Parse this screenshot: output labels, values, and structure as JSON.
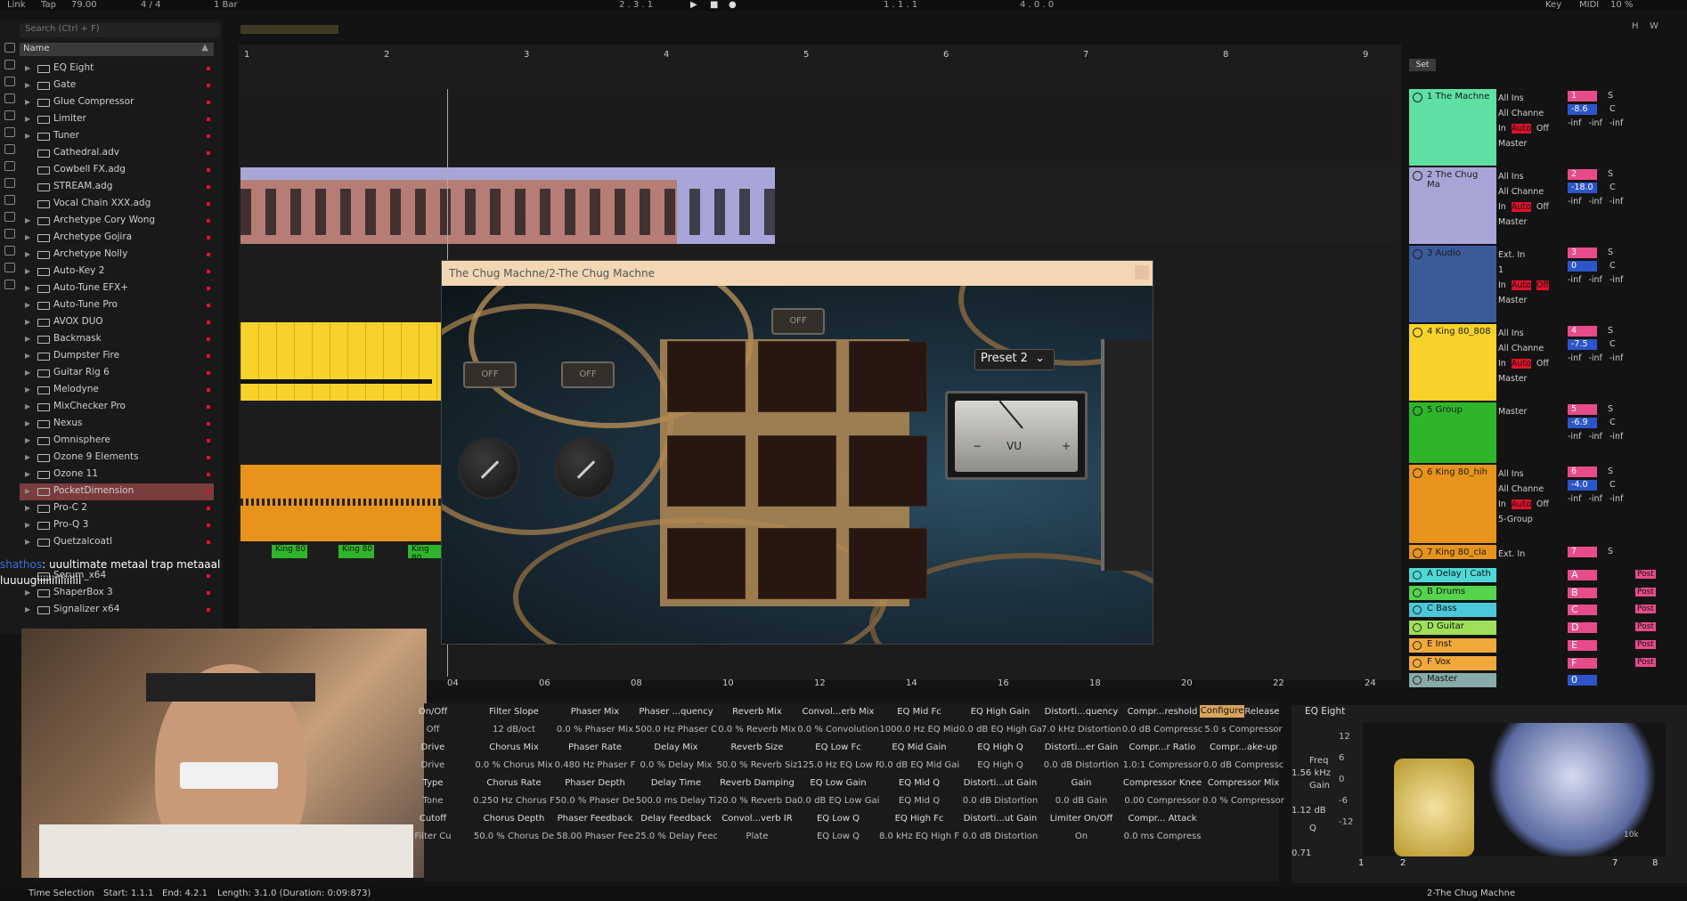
{
  "topbar": {
    "link": "Link",
    "tap": "Tap",
    "tempo": "79.00",
    "signature": "4 / 4",
    "quantize": "1 Bar",
    "position": "2 . 3 . 1",
    "loop_start": "1 . 1 . 1",
    "loop_length": "4 . 0 . 0",
    "key": "Key",
    "midi": "MIDI",
    "cpu": "10 %",
    "h": "H",
    "w": "W"
  },
  "browser": {
    "search_placeholder": "Search (Ctrl + F)",
    "col_name": "Name",
    "items": [
      {
        "label": "EQ Eight",
        "expand": true
      },
      {
        "label": "Gate",
        "expand": true
      },
      {
        "label": "Glue Compressor",
        "expand": true
      },
      {
        "label": "Limiter",
        "expand": true
      },
      {
        "label": "Tuner",
        "expand": true
      },
      {
        "label": "Cathedral.adv",
        "expand": false
      },
      {
        "label": "Cowbell FX.adg",
        "expand": false
      },
      {
        "label": "STREAM.adg",
        "expand": false
      },
      {
        "label": "Vocal Chain XXX.adg",
        "expand": false
      },
      {
        "label": "Archetype Cory Wong",
        "expand": true
      },
      {
        "label": "Archetype Gojira",
        "expand": true
      },
      {
        "label": "Archetype Nolly",
        "expand": true
      },
      {
        "label": "Auto-Key 2",
        "expand": true
      },
      {
        "label": "Auto-Tune EFX+",
        "expand": true
      },
      {
        "label": "Auto-Tune Pro",
        "expand": true
      },
      {
        "label": "AVOX DUO",
        "expand": true
      },
      {
        "label": "Backmask",
        "expand": true
      },
      {
        "label": "Dumpster Fire",
        "expand": true
      },
      {
        "label": "Guitar Rig 6",
        "expand": true
      },
      {
        "label": "Melodyne",
        "expand": true
      },
      {
        "label": "MixChecker Pro",
        "expand": true
      },
      {
        "label": "Nexus",
        "expand": true
      },
      {
        "label": "Omnisphere",
        "expand": true
      },
      {
        "label": "Ozone 9 Elements",
        "expand": true
      },
      {
        "label": "Ozone 11",
        "expand": true
      },
      {
        "label": "PocketDimension",
        "expand": true
      },
      {
        "label": "Pro-C 2",
        "expand": true
      },
      {
        "label": "Pro-Q 3",
        "expand": true
      },
      {
        "label": "Quetzalcoatl",
        "expand": true
      },
      {
        "label": "",
        "expand": false
      },
      {
        "label": "Serum_x64",
        "expand": false
      },
      {
        "label": "ShaperBox 3",
        "expand": true
      },
      {
        "label": "Signalizer x64",
        "expand": true
      }
    ]
  },
  "chat": {
    "user": "shathos",
    "line1": ": uuultimate metaal trap metaaal",
    "line2": "luuuugiiiiiiiiiiiiiii"
  },
  "ruler": [
    "1",
    "2",
    "3",
    "4",
    "5",
    "6",
    "7",
    "8",
    "9"
  ],
  "timeline": [
    "04",
    "06",
    "08",
    "10",
    "12",
    "14",
    "16",
    "18",
    "20",
    "22",
    "24"
  ],
  "clip_labels": [
    "King 80",
    "King 80",
    "King 80"
  ],
  "plugin": {
    "title": "The Chug Machne/2-The Chug Machne",
    "off": "OFF",
    "preset": "Preset 2",
    "vu": "VU",
    "minus": "−",
    "plus": "+"
  },
  "tracks": [
    {
      "name": "1 The Machne",
      "color": "#5ee0a3",
      "input": "All Ins",
      "channel": "All Channe",
      "output": "Master",
      "num": "1",
      "vol": "-8.6",
      "monitor": [
        "In",
        "Auto",
        "Off"
      ]
    },
    {
      "name": "2 The Chug Ma",
      "color": "#a8a5d6",
      "input": "All Ins",
      "channel": "All Channe",
      "output": "Master",
      "num": "2",
      "vol": "-18.0",
      "monitor": [
        "In",
        "Auto",
        "Off"
      ]
    },
    {
      "name": "3 Audio",
      "color": "#3a5a9a",
      "input": "Ext. In",
      "channel": "1",
      "output": "Master",
      "num": "3",
      "vol": "0",
      "monitor": [
        "In",
        "Auto",
        "Off"
      ]
    },
    {
      "name": "4 King 80_808",
      "color": "#f7d22a",
      "input": "All Ins",
      "channel": "All Channe",
      "output": "Master",
      "num": "4",
      "vol": "-7.5",
      "monitor": [
        "In",
        "Auto",
        "Off"
      ]
    },
    {
      "name": "5 Group",
      "color": "#2fb52a",
      "input": "Master",
      "channel": "",
      "output": "",
      "num": "5",
      "vol": "-6.9",
      "monitor": []
    },
    {
      "name": "6 King 80_hih",
      "color": "#e8941c",
      "input": "All Ins",
      "channel": "All Channe",
      "output": "5-Group",
      "num": "6",
      "vol": "-4.0",
      "monitor": [
        "In",
        "Auto",
        "Off"
      ]
    },
    {
      "name": "7 King 80_cla",
      "color": "#e8941c",
      "input": "Ext. In",
      "channel": "",
      "output": "",
      "num": "7",
      "vol": "",
      "monitor": []
    }
  ],
  "returns": [
    {
      "name": "A Delay | Cath",
      "color": "#4fd8d8",
      "letter": "A"
    },
    {
      "name": "B Drums",
      "color": "#55d34d",
      "letter": "B"
    },
    {
      "name": "C Bass",
      "color": "#4dc8d8",
      "letter": "C"
    },
    {
      "name": "D Guitar",
      "color": "#9fe05a",
      "letter": "D"
    },
    {
      "name": "E Inst",
      "color": "#f2a93b",
      "letter": "E"
    },
    {
      "name": "F Vox",
      "color": "#f2a93b",
      "letter": "F"
    },
    {
      "name": "Master",
      "color": "#8aa",
      "letter": "0"
    }
  ],
  "mixer": {
    "inf": "-inf",
    "c": "C",
    "s": "S",
    "post": "Post",
    "set": "Set"
  },
  "device": {
    "configure": "Configure",
    "columns": [
      [
        "On/Off",
        "Off",
        "Drive",
        "Drive",
        "Type",
        "Tone",
        "Cutoff",
        "Filter Cu"
      ],
      [
        "Filter Slope",
        "12 dB/oct",
        "Chorus Mix",
        "0.0 % Chorus Mix",
        "Chorus Rate",
        "0.250 Hz Chorus F",
        "Chorus Depth",
        "50.0 % Chorus De"
      ],
      [
        "Phaser Mix",
        "0.0 % Phaser Mix",
        "Phaser Rate",
        "0.480 Hz Phaser F",
        "Phaser Depth",
        "50.0 % Phaser De",
        "Phaser Feedback",
        "58.00 Phaser Fee"
      ],
      [
        "Phaser ...quency",
        "500.0 Hz Phaser C",
        "Delay Mix",
        "0.0 % Delay Mix",
        "Delay Time",
        "500.0 ms Delay Ti",
        "Delay Feedback",
        "25.0 % Delay Feec"
      ],
      [
        "Reverb Mix",
        "0.0 % Reverb Mix",
        "Reverb Size",
        "50.0 % Reverb Siz",
        "Reverb Damping",
        "20.0 % Reverb Da",
        "Convol...verb IR",
        "Plate"
      ],
      [
        "Convol...erb Mix",
        "0.0 % Convolution",
        "EQ Low Fc",
        "125.0 Hz EQ Low F",
        "EQ Low Gain",
        "0.0 dB EQ Low Gai",
        "EQ Low Q",
        "EQ Low Q"
      ],
      [
        "EQ Mid Fc",
        "1000.0 Hz EQ Mid",
        "EQ Mid Gain",
        "0.0 dB EQ Mid Gai",
        "EQ Mid Q",
        "EQ Mid Q",
        "EQ High Fc",
        "8.0 kHz EQ High F"
      ],
      [
        "EQ High Gain",
        "0.0 dB EQ High Ga",
        "EQ High Q",
        "EQ High Q",
        "Distorti...ut Gain",
        "0.0 dB Distortion",
        "Distorti...ut Gain",
        "0.0 dB Distortion"
      ],
      [
        "Distorti...quency",
        "7.0 kHz Distortion",
        "Distorti...er Gain",
        "0.0 dB Distortion",
        "Gain",
        "0.0 dB Gain",
        "Limiter On/Off",
        "On"
      ],
      [
        "Compr...reshold",
        "0.0 dB Compressc",
        "Compr...r Ratio",
        "1.0:1 Compressor",
        "Compressor Knee",
        "0.00 Compressor",
        "Compr... Attack",
        "0.0 ms Compress"
      ],
      [
        "Compr...Release",
        "5.0 s Compressor",
        "Compr...ake-up",
        "0.0 dB Compressc",
        "Compressor Mix",
        "0.0 % Compressor",
        "",
        ""
      ]
    ]
  },
  "eq": {
    "title": "EQ Eight",
    "freq_label": "Freq",
    "freq": "1.56 kHz",
    "gain_label": "Gain",
    "gain": "1.12 dB",
    "q_label": "Q",
    "q": "0.71",
    "scale": [
      "12",
      "6",
      "0",
      "-6",
      "-12"
    ],
    "freq_tick": "10k",
    "band1": "1",
    "band2": "2",
    "band7": "7",
    "band8": "8"
  },
  "status": {
    "selection": "Time Selection",
    "start": "Start: 1.1.1",
    "end": "End: 4.2.1",
    "length": "Length: 3.1.0 (Duration: 0:09:873)",
    "track": "2-The Chug Machne"
  }
}
